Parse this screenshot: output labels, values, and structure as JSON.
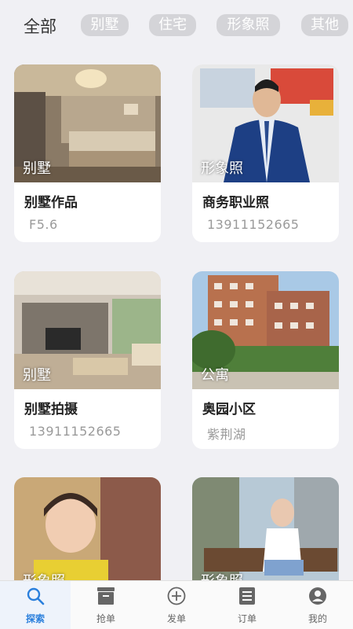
{
  "filters": {
    "all": "全部",
    "chips": [
      "别墅",
      "住宅",
      "形象照",
      "其他"
    ]
  },
  "cards": [
    {
      "tag": "别墅",
      "title": "别墅作品",
      "sub": "F5.6"
    },
    {
      "tag": "形象照",
      "title": "商务职业照",
      "sub": "13911152665"
    },
    {
      "tag": "别墅",
      "title": "别墅拍摄",
      "sub": "13911152665"
    },
    {
      "tag": "公寓",
      "title": "奥园小区",
      "sub": "紫荆湖"
    },
    {
      "tag": "形象照",
      "title": "",
      "sub": ""
    },
    {
      "tag": "形象照",
      "title": "",
      "sub": ""
    }
  ],
  "tabs": [
    {
      "label": "探索",
      "icon": "search-icon",
      "active": true
    },
    {
      "label": "抢单",
      "icon": "inbox-icon"
    },
    {
      "label": "发单",
      "icon": "plus-circle-icon"
    },
    {
      "label": "订单",
      "icon": "list-icon"
    },
    {
      "label": "我的",
      "icon": "user-icon"
    }
  ],
  "colors": {
    "accent": "#2a7fdc",
    "background": "#f0f0f4",
    "chip": "#d4d4d8"
  }
}
